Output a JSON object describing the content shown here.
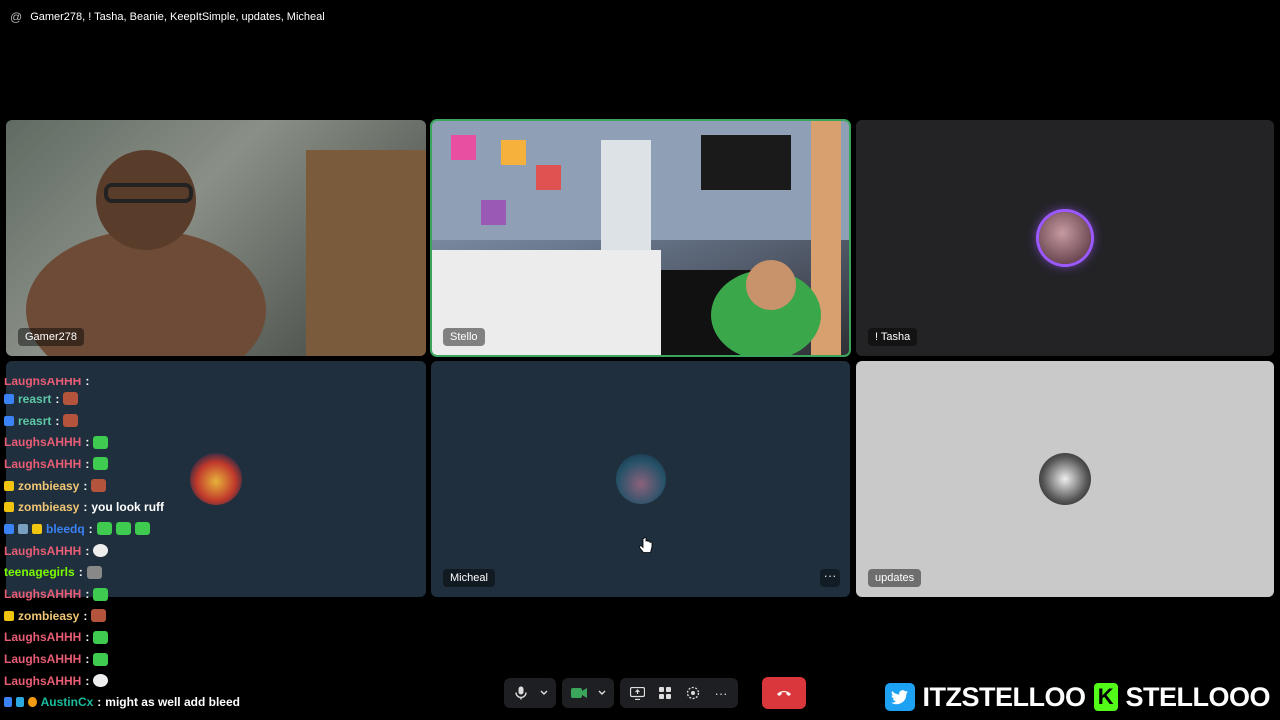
{
  "header": {
    "participants_label": "Gamer278, ! Tasha, Beanie, KeepItSimple, updates, Micheal"
  },
  "tiles": {
    "gamer": {
      "name": "Gamer278"
    },
    "stello": {
      "name": "Stello"
    },
    "tasha": {
      "name": "! Tasha"
    },
    "beanie": {
      "name": ""
    },
    "micheal": {
      "name": "Micheal",
      "more": "···"
    },
    "updates": {
      "name": "updates"
    }
  },
  "chat": [
    {
      "user": "LaughsAHHH",
      "color": "#e85d75",
      "text": ""
    },
    {
      "user": "reasrt",
      "color": "#5ec8a6",
      "text": ""
    },
    {
      "user": "reasrt",
      "color": "#5ec8a6",
      "text": ""
    },
    {
      "user": "LaughsAHHH",
      "color": "#e85d75",
      "text": ""
    },
    {
      "user": "LaughsAHHH",
      "color": "#e85d75",
      "text": ""
    },
    {
      "user": "zombieasy",
      "color": "#f0c674",
      "text": ""
    },
    {
      "user": "zombieasy",
      "color": "#f0c674",
      "text": "you look ruff"
    },
    {
      "user": "bleedq",
      "color": "#3b82f6",
      "text": ""
    },
    {
      "user": "LaughsAHHH",
      "color": "#e85d75",
      "text": ""
    },
    {
      "user": "teenagegirls",
      "color": "#7cfc00",
      "text": ""
    },
    {
      "user": "LaughsAHHH",
      "color": "#e85d75",
      "text": ""
    },
    {
      "user": "zombieasy",
      "color": "#f0c674",
      "text": ""
    },
    {
      "user": "LaughsAHHH",
      "color": "#e85d75",
      "text": ""
    },
    {
      "user": "LaughsAHHH",
      "color": "#e85d75",
      "text": ""
    },
    {
      "user": "LaughsAHHH",
      "color": "#e85d75",
      "text": ""
    },
    {
      "user": "AustinCx",
      "color": "#1abc9c",
      "text": "might as well add bleed"
    }
  ],
  "controls": {
    "mic": "microphone-icon",
    "camera": "camera-icon",
    "share": "screen-share-icon",
    "activities": "activities-icon",
    "soundboard": "soundboard-icon",
    "more": "···",
    "hangup": "phone-hangup-icon",
    "accent": "#da373c"
  },
  "social": {
    "twitter": "ITZSTELLOO",
    "kick": "STELLOOO"
  }
}
